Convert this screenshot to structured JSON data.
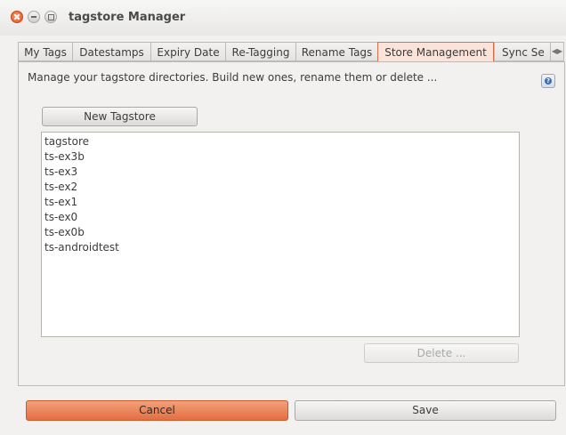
{
  "window": {
    "title": "tagstore Manager"
  },
  "tabs": [
    {
      "label": "My Tags"
    },
    {
      "label": "Datestamps"
    },
    {
      "label": "Expiry Date"
    },
    {
      "label": "Re-Tagging"
    },
    {
      "label": "Rename Tags"
    },
    {
      "label": "Store Management"
    },
    {
      "label": "Sync Se"
    }
  ],
  "active_tab": "Store Management",
  "store_management": {
    "description": "Manage your tagstore directories. Build new ones, rename them or delete ...",
    "new_button_label": "New Tagstore",
    "delete_button_label": "Delete ...",
    "stores": [
      {
        "name": "tagstore"
      },
      {
        "name": "ts-ex3b"
      },
      {
        "name": "ts-ex3"
      },
      {
        "name": "ts-ex2"
      },
      {
        "name": "ts-ex1"
      },
      {
        "name": "ts-ex0"
      },
      {
        "name": "ts-ex0b"
      },
      {
        "name": "ts-androidtest"
      }
    ]
  },
  "footer": {
    "cancel_label": "Cancel",
    "save_label": "Save"
  },
  "colors": {
    "accent": "#e46e3f",
    "active_tab_bg": "#fbe3d9"
  },
  "icons": {
    "help": "help-icon",
    "tab_scroll": "tab-scroll-arrows-icon",
    "close": "close-icon",
    "minimize": "minimize-icon",
    "maximize": "maximize-icon"
  }
}
